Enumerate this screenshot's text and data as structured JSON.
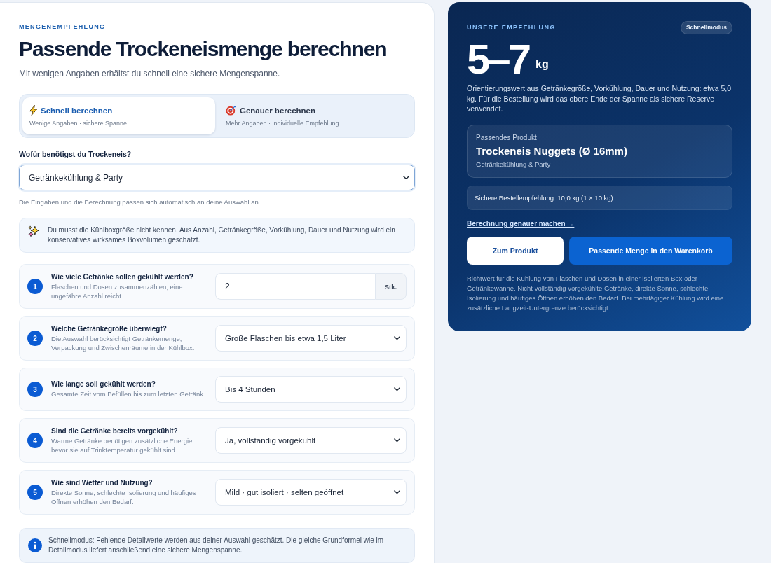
{
  "calculator": {
    "eyebrow": "MENGENEMPFEHLUNG",
    "title": "Passende Trockeneismenge berechnen",
    "subtitle": "Mit wenigen Angaben erhältst du schnell eine sichere Mengenspanne.",
    "modes": [
      {
        "kind": "quick",
        "label": "Schnell berechnen",
        "hint": "Wenige Angaben · sichere Spanne",
        "selected": true
      },
      {
        "kind": "precise",
        "label": "Genauer berechnen",
        "hint": "Mehr Angaben · individuelle Empfehlung",
        "selected": false
      }
    ],
    "purpose": {
      "label": "Wofür benötigst du Trockeneis?",
      "value": "Getränkekühlung & Party",
      "focused": true,
      "hint": "Die Eingaben und die Berechnung passen sich automatisch an deine Auswahl an."
    },
    "notice": "Du musst die Kühlboxgröße nicht kennen. Aus Anzahl, Getränkegröße, Vorkühlung, Dauer und Nutzung wird ein konservatives wirksames Boxvolumen geschätzt.",
    "questions": [
      {
        "number": "1",
        "title": "Wie viele Getränke sollen gekühlt werden?",
        "description": "Flaschen und Dosen zusammenzählen; eine ungefähre Anzahl reicht.",
        "kind": "number",
        "value": "2",
        "unit": "Stk."
      },
      {
        "number": "2",
        "title": "Welche Getränkegröße überwiegt?",
        "description": "Die Auswahl berücksichtigt Getränkemenge, Verpackung und Zwischenräume in der Kühlbox.",
        "kind": "select",
        "value": "Große Flaschen bis etwa 1,5 Liter"
      },
      {
        "number": "3",
        "title": "Wie lange soll gekühlt werden?",
        "description": "Gesamte Zeit vom Befüllen bis zum letzten Getränk.",
        "kind": "select",
        "value": "Bis 4 Stunden"
      },
      {
        "number": "4",
        "title": "Sind die Getränke bereits vorgekühlt?",
        "description": "Warme Getränke benötigen zusätzliche Energie, bevor sie auf Trinktemperatur gekühlt sind.",
        "kind": "select",
        "value": "Ja, vollständig vorgekühlt"
      },
      {
        "number": "5",
        "title": "Wie sind Wetter und Nutzung?",
        "description": "Direkte Sonne, schlechte Isolierung und häufiges Öffnen erhöhen den Bedarf.",
        "kind": "select",
        "value": "Mild · gut isoliert · selten geöffnet"
      }
    ],
    "footer_note": "Schnellmodus: Fehlende Detailwerte werden aus deiner Auswahl geschätzt. Die gleiche Grundformel wie im Detailmodus liefert anschließend eine sichere Mengenspanne."
  },
  "recommendation": {
    "eyebrow": "UNSERE EMPFEHLUNG",
    "mode_badge": "Schnellmodus",
    "amount": "5–7",
    "unit": "kg",
    "explanation": "Orientierungswert aus Getränkegröße, Vorkühlung, Dauer und Nutzung: etwa 5,0 kg. Für die Bestellung wird das obere Ende der Spanne als sichere Reserve verwendet.",
    "product": {
      "caption": "Passendes Produkt",
      "name": "Trockeneis Nuggets (Ø 16mm)",
      "use": "Getränkekühlung & Party"
    },
    "order_hint": "Sichere Bestellempfehlung: 10,0 kg (1 × 10 kg).",
    "refine_link": "Berechnung genauer machen →",
    "buttons": [
      {
        "kind": "secondary",
        "label": "Zum Produkt"
      },
      {
        "kind": "primary",
        "label": "Passende Menge in den Warenkorb"
      }
    ],
    "disclaimer": "Richtwert für die Kühlung von Flaschen und Dosen in einer isolierten Box oder Getränkewanne. Nicht vollständig vorgekühlte Getränke, direkte Sonne, schlechte Isolierung und häufiges Öffnen erhöhen den Bedarf. Bei mehrtägiger Kühlung wird eine zusätzliche Langzeit-Untergrenze berücksichtigt."
  }
}
